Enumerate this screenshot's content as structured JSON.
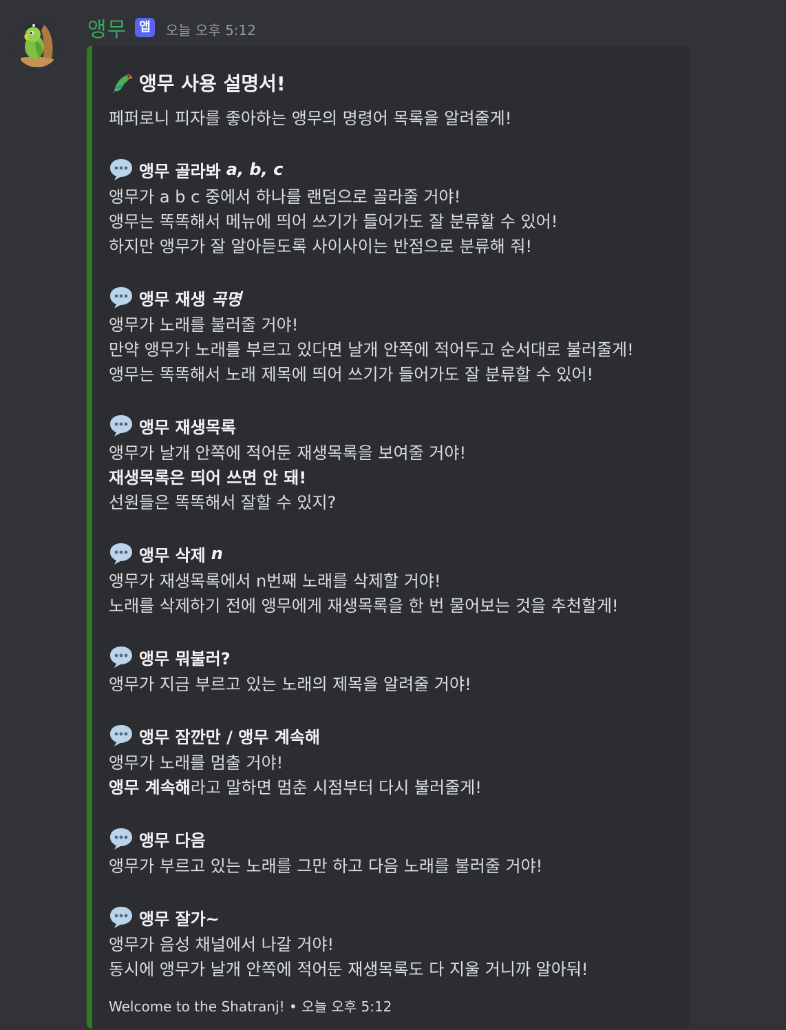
{
  "message": {
    "author": "앵무",
    "badge": "앱",
    "timestamp": "오늘 오후 5:12"
  },
  "colors": {
    "username": "#3ba55d",
    "badge": "#5865f2",
    "embed_bar": "#2d7d1e",
    "embed_bg": "#2b2d31",
    "page_bg": "#313338"
  },
  "embed": {
    "title_icon": "parrot-icon",
    "title": "앵무 사용 설명서!",
    "intro": "페퍼로니 피자를 좋아하는 앵무의 명령어 목록을 알려줄게!",
    "commands": [
      {
        "icon": "speech-bubble-icon",
        "name": "앵무 골라봐",
        "arg": "a, b, c",
        "lines": [
          "앵무가 a b c 중에서 하나를 랜덤으로 골라줄 거야!",
          "앵무는 똑똑해서 메뉴에 띄어 쓰기가 들어가도 잘 분류할 수 있어!",
          "하지만 앵무가 잘 알아듣도록 사이사이는 반점으로 분류해 줘!"
        ]
      },
      {
        "icon": "speech-bubble-icon",
        "name": "앵무 재생",
        "arg": "곡명",
        "lines": [
          "앵무가 노래를 불러줄 거야!",
          "만약 앵무가 노래를 부르고 있다면 날개 안쪽에 적어두고 순서대로 불러줄게!",
          "앵무는 똑똑해서 노래 제목에 띄어 쓰기가 들어가도 잘 분류할 수 있어!"
        ]
      },
      {
        "icon": "speech-bubble-icon",
        "name": "앵무 재생목록",
        "arg": "",
        "lines": [
          "앵무가 날개 안쪽에 적어둔 재생목록을 보여줄 거야!"
        ],
        "bold_line": "재생목록은 띄어 쓰면 안 돼!",
        "extra_line": "선원들은 똑똑해서 잘할 수 있지?"
      },
      {
        "icon": "speech-bubble-icon",
        "name": "앵무 삭제",
        "arg": "n",
        "lines": [
          "앵무가 재생목록에서 n번째 노래를 삭제할 거야!",
          "노래를 삭제하기 전에 앵무에게 재생목록을 한 번 물어보는 것을 추천할게!"
        ]
      },
      {
        "icon": "speech-bubble-icon",
        "name": "앵무 뭐불러?",
        "arg": "",
        "lines": [
          "앵무가 지금 부르고 있는 노래의 제목을 알려줄 거야!"
        ]
      },
      {
        "icon": "speech-bubble-icon",
        "name": "앵무 잠깐만 / 앵무 계속해",
        "arg": "",
        "lines": [
          "앵무가 노래를 멈출 거야!"
        ],
        "mixed_bold": "앵무 계속해",
        "mixed_rest": "라고 말하면 멈춘 시점부터 다시 불러줄게!"
      },
      {
        "icon": "speech-bubble-icon",
        "name": "앵무 다음",
        "arg": "",
        "lines": [
          "앵무가 부르고 있는 노래를 그만 하고 다음 노래를 불러줄 거야!"
        ]
      },
      {
        "icon": "speech-bubble-icon",
        "name": "앵무 잘가~",
        "arg": "",
        "lines": [
          "앵무가 음성 채널에서 나갈 거야!",
          "동시에 앵무가 날개 안쪽에 적어둔 재생목록도 다 지울 거니까 알아둬!"
        ]
      }
    ],
    "footer": {
      "text": "Welcome to the Shatranj!",
      "separator": "•",
      "timestamp": "오늘 오후 5:12"
    }
  }
}
